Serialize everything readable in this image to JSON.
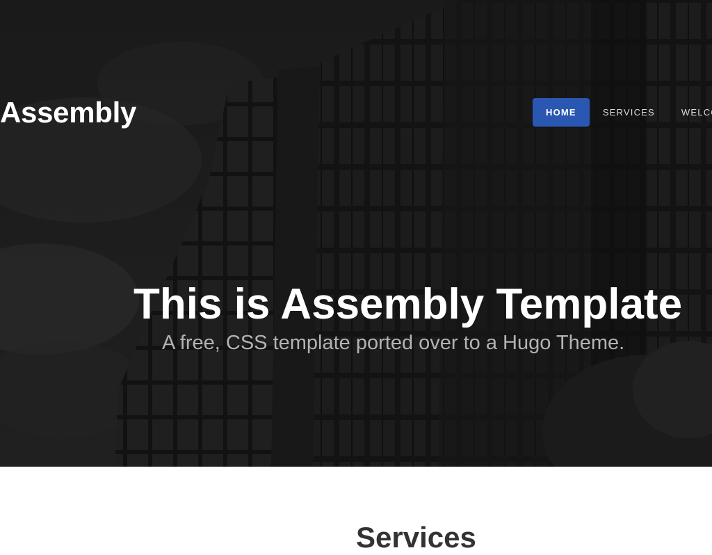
{
  "site": {
    "title": "Assembly"
  },
  "nav": {
    "items": [
      {
        "label": "HOME",
        "active": true
      },
      {
        "label": "SERVICES",
        "active": false
      },
      {
        "label": "WELCOME",
        "active": false
      }
    ]
  },
  "hero": {
    "title": "This is Assembly Template",
    "subtitle": "A free, CSS template ported over to a Hugo Theme."
  },
  "services": {
    "title": "Services"
  },
  "colors": {
    "accent": "#2a57b2",
    "hero_overlay": "#1b1b1b",
    "page_background": "#ffffff"
  }
}
